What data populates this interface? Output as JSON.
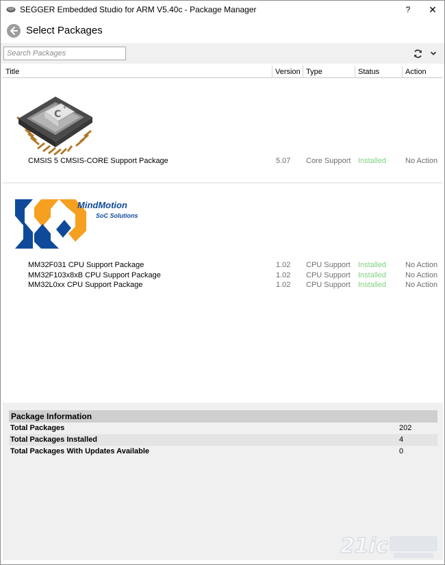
{
  "window": {
    "title": "SEGGER Embedded Studio for ARM V5.40c - Package Manager",
    "help_label": "?",
    "close_label": "✕"
  },
  "header": {
    "title": "Select Packages"
  },
  "toolbar": {
    "search_placeholder": "Search Packages",
    "search_value": ""
  },
  "columns": {
    "title": "Title",
    "version": "Version",
    "type": "Type",
    "status": "Status",
    "action": "Action"
  },
  "packages": [
    {
      "title": "CMSIS 5 CMSIS-CORE Support Package",
      "version": "5.07",
      "type": "Core Support",
      "status": "Installed",
      "action": "No Action"
    },
    {
      "title": "MM32F031 CPU Support Package",
      "version": "1.02",
      "type": "CPU Support",
      "status": "Installed",
      "action": "No Action"
    },
    {
      "title": "MM32F103x8xB CPU Support Package",
      "version": "1.02",
      "type": "CPU Support",
      "status": "Installed",
      "action": "No Action"
    },
    {
      "title": "MM32L0xx CPU Support Package",
      "version": "1.02",
      "type": "CPU Support",
      "status": "Installed",
      "action": "No Action"
    }
  ],
  "logos": {
    "mindmotion_name": "MindMotion",
    "mindmotion_sub": "SoC Solutions"
  },
  "info": {
    "heading": "Package Information",
    "rows": [
      {
        "label": "Total Packages",
        "value": "202"
      },
      {
        "label": "Total Packages Installed",
        "value": "4"
      },
      {
        "label": "Total Packages With Updates Available",
        "value": "0"
      }
    ]
  },
  "colors": {
    "installed_status": "#7ed07e",
    "mindmotion_blue": "#0f4a9a",
    "mindmotion_orange": "#f5a020"
  },
  "icons": {
    "app": "segger-app-icon",
    "back": "back-arrow-icon",
    "refresh": "refresh-icon",
    "dropdown": "chevron-down-icon"
  }
}
